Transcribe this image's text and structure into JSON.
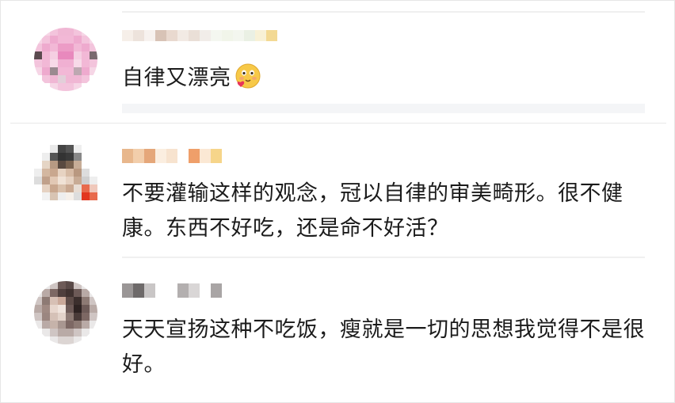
{
  "comments": [
    {
      "text": "自律又漂亮",
      "emoji": "blushing-face-with-heart-emoji",
      "avatar_color": "#f2b8d6"
    },
    {
      "text": "不要灌输这样的观念，冠以自律的审美畸形。很不健康。东西不好吃，还是命不好活？",
      "avatar_color": "#c9a78e"
    },
    {
      "text": "天天宣扬这种不吃饭，瘦就是一切的思想我觉得不是很好。",
      "avatar_color": "#8d7a74"
    }
  ]
}
